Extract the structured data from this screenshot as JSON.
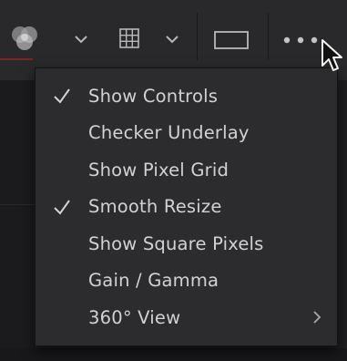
{
  "toolbar": {
    "icons": [
      "color-channels-icon",
      "chevron-down-icon",
      "grid-icon",
      "chevron-down-icon",
      "frame-rectangle-icon",
      "more-options-icon"
    ],
    "accent": "#7a2626"
  },
  "menu": {
    "items": [
      {
        "label": "Show Controls",
        "checked": true,
        "submenu": false
      },
      {
        "label": "Checker Underlay",
        "checked": false,
        "submenu": false
      },
      {
        "label": "Show Pixel Grid",
        "checked": false,
        "submenu": false
      },
      {
        "label": "Smooth Resize",
        "checked": true,
        "submenu": false
      },
      {
        "label": "Show Square Pixels",
        "checked": false,
        "submenu": false
      },
      {
        "label": "Gain / Gamma",
        "checked": false,
        "submenu": false
      },
      {
        "label": "360° View",
        "checked": false,
        "submenu": true
      }
    ]
  },
  "colors": {
    "background": "#1e1e20",
    "toolbar": "#29292b",
    "menu": "#2c2c2e",
    "text": "#d2d2d2",
    "icon": "#b8b8b8"
  }
}
